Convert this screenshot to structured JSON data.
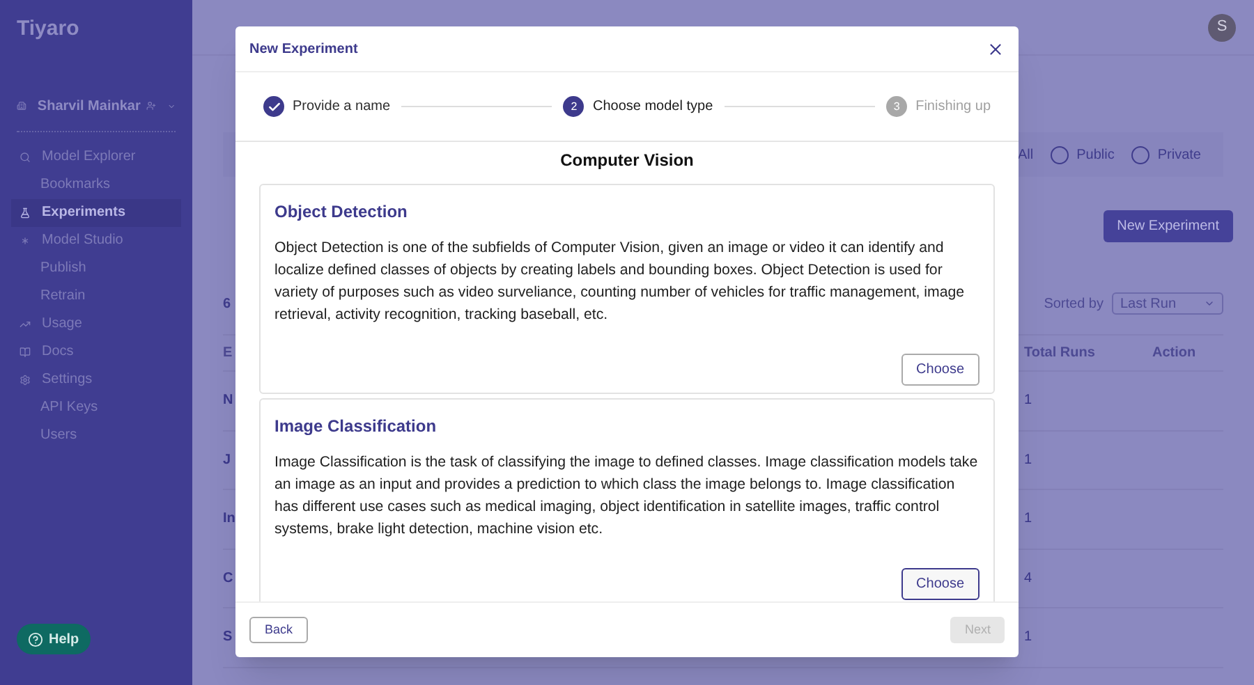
{
  "sidebar": {
    "logo": "Tiyaro",
    "user": {
      "name": "Sharvil Mainkar"
    },
    "items": [
      {
        "label": "Model Explorer",
        "selected": false,
        "children": [
          {
            "label": "Bookmarks",
            "selected": false
          }
        ]
      },
      {
        "label": "Experiments",
        "selected": true
      },
      {
        "label": "Model Studio",
        "selected": false,
        "children": [
          {
            "label": "Publish",
            "selected": false
          },
          {
            "label": "Retrain",
            "selected": false
          }
        ]
      },
      {
        "label": "Usage",
        "selected": false
      },
      {
        "label": "Docs",
        "selected": false
      },
      {
        "label": "Settings",
        "selected": false,
        "children": [
          {
            "label": "API Keys",
            "selected": false
          },
          {
            "label": "Users",
            "selected": false
          }
        ]
      }
    ],
    "help": "Help"
  },
  "header": {
    "avatar": "S"
  },
  "filters": [
    {
      "label": "All"
    },
    {
      "label": "Public",
      "selected": false
    },
    {
      "label": "Private",
      "selected": false
    }
  ],
  "new_button": "New Experiment",
  "count": "6",
  "sort": {
    "label": "Sorted by",
    "value": "Last Run"
  },
  "table": {
    "columns": [
      "E",
      "Total Runs",
      "Action"
    ],
    "rows": [
      {
        "name": "N",
        "runs": "1"
      },
      {
        "name": "J",
        "runs": "1"
      },
      {
        "name": "In",
        "runs": "1"
      },
      {
        "name": "C",
        "runs": "4"
      },
      {
        "name": "S",
        "runs": "1"
      }
    ]
  },
  "dialog": {
    "title": "New Experiment",
    "steps": [
      {
        "label": "Provide a name",
        "completed": true,
        "selected": false
      },
      {
        "number": "2",
        "label": "Choose model type",
        "completed": false,
        "selected": true
      },
      {
        "number": "3",
        "label": "Finishing up",
        "completed": false,
        "selected": false
      }
    ],
    "section": "Computer Vision",
    "cards": [
      {
        "title": "Object Detection",
        "description": "Object Detection is one of the subfields of Computer Vision, given an image or video it can identify and localize defined classes of objects by creating labels and bounding boxes. Object Detection is used for variety of purposes such as video surveliance, counting number of vehicles for traffic management, image retrieval, activity recognition, tracking baseball, etc.",
        "button": "Choose",
        "focused": false
      },
      {
        "title": "Image Classification",
        "description": "Image Classification is the task of classifying the image to defined classes. Image classification models take an image as an input and provides a prediction to which class the image belongs to. Image classification has different use cases such as medical imaging, object identification in satellite images, traffic control systems, brake light detection, machine vision etc.",
        "button": "Choose",
        "focused": true
      }
    ],
    "back": "Back",
    "next": {
      "label": "Next",
      "disabled": true
    }
  }
}
